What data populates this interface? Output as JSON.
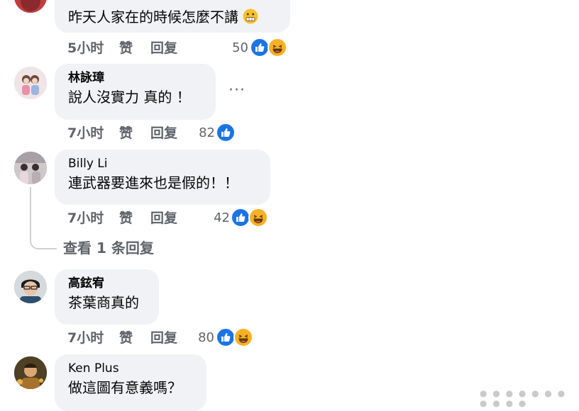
{
  "colors": {
    "bubble_bg": "#f0f2f5",
    "meta_text": "#5f646b",
    "like_blue": "#1b74e4",
    "haha_yellow": "#f7b125"
  },
  "comments": [
    {
      "author": "",
      "text": "昨天人家在的時候怎麼不講",
      "emoji": "grimacing-emoji",
      "time": "5小时",
      "like": "赞",
      "reply": "回复",
      "count": "50",
      "reactions": [
        "like-icon",
        "haha-icon"
      ]
    },
    {
      "author": "林詠璋",
      "text": "說人沒實力 真的 ！",
      "time": "7小时",
      "like": "赞",
      "reply": "回复",
      "count": "82",
      "reactions": [
        "like-icon"
      ],
      "more": "···"
    },
    {
      "author": "Billy Li",
      "text": "連武器要進來也是假的！！",
      "time": "7小时",
      "like": "赞",
      "reply": "回复",
      "count": "42",
      "reactions": [
        "like-icon",
        "haha-icon"
      ],
      "view_replies": "查看 1 条回复"
    },
    {
      "author": "高鉉宥",
      "text": "茶葉商真的",
      "time": "7小时",
      "like": "赞",
      "reply": "回复",
      "count": "80",
      "reactions": [
        "like-icon",
        "haha-icon"
      ]
    },
    {
      "author": "Ken Plus",
      "text": "做這圖有意義嗎？"
    }
  ]
}
